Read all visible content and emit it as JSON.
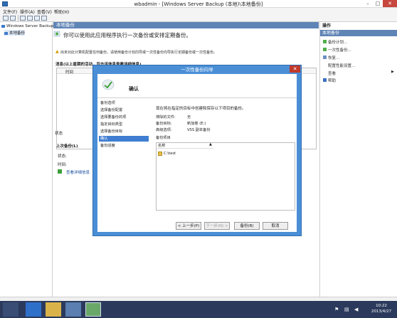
{
  "window": {
    "title": "wbadmin - [Windows Server Backup (本地)\\本地备份]",
    "controls": [
      "–",
      "□",
      "✕"
    ]
  },
  "menubar": [
    "文件(F)",
    "操作(A)",
    "查看(V)",
    "帮助(H)"
  ],
  "tree": {
    "root": "Windows Server Backup",
    "child": "本地备份"
  },
  "center": {
    "header": "本地备份",
    "intro": "你可以使用此应用程序执行一次备份或安排定期备份。",
    "warning": "尚未对此计算机配置任何备份。请使用备份计划向导或一次性备份向导执行定期备份或一次性备份。",
    "messages_label": "消息(以上星期的活动，双击该信息查看详细信息)",
    "messages_columns": [
      "时间",
      "消息",
      "描述"
    ],
    "status_label": "状态",
    "last_backup_label": "上次备份(L)",
    "status_state": "状态:",
    "status_time": "时间:",
    "view_details": "查看详细信息"
  },
  "actions": {
    "header": "操作",
    "sub": "本地备份",
    "items": [
      "备份计划...",
      "一次性备份...",
      "恢复...",
      "配置性能设置...",
      "查看",
      "帮助"
    ]
  },
  "wizard": {
    "title": "一次性备份向导",
    "close": "✕",
    "page_title": "确认",
    "steps": [
      "备份选项",
      "选择备份配置",
      "选择要备份的项",
      "指定目标类型",
      "选择备份目标",
      "确认",
      "备份进度"
    ],
    "active_step_index": 5,
    "description": "现在将在指定的目标中创建和保存以下项目的备份。",
    "details": [
      {
        "label": "排除的文件:",
        "value": "无"
      },
      {
        "label": "备份目标:",
        "value": "新加卷 (E:)"
      },
      {
        "label": "高级选项:",
        "value": "VSS 副本备份"
      }
    ],
    "items_label": "备份项目",
    "items_column": "名称",
    "items": [
      "C:\\test"
    ],
    "buttons": {
      "back": "< 上一步(P)",
      "next": "下一步(N) >",
      "backup": "备份(B)",
      "cancel": "取消"
    }
  },
  "taskbar": {
    "time": "10:22",
    "date": "2013/4/27"
  }
}
